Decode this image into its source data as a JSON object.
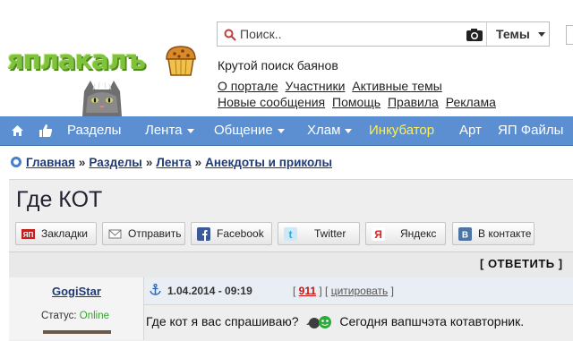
{
  "logo": {
    "text": "яплакалъ"
  },
  "search": {
    "placeholder": "Поиск..",
    "scope": "Темы"
  },
  "tagline": "Крутой поиск баянов",
  "toplinks": {
    "row1": [
      "О портале",
      "Участники",
      "Активные темы"
    ],
    "row2": [
      "Новые сообщения",
      "Помощь",
      "Правила",
      "Реклама"
    ]
  },
  "nav": {
    "items": [
      {
        "label": "Разделы",
        "dropdown": false
      },
      {
        "label": "Лента",
        "dropdown": true
      },
      {
        "label": "Общение",
        "dropdown": true
      },
      {
        "label": "Хлам",
        "dropdown": true
      },
      {
        "label": "Инкубатор",
        "dropdown": false,
        "highlight": true
      },
      {
        "label": "Арт",
        "dropdown": false
      },
      {
        "label": "ЯП Файлы",
        "dropdown": false
      }
    ]
  },
  "breadcrumb": {
    "items": [
      "Главная",
      "Разделы",
      "Лента",
      "Анекдоты и приколы"
    ],
    "separator": "»"
  },
  "topic": {
    "title": "Где КОТ"
  },
  "share": {
    "buttons": [
      {
        "label": "Закладки",
        "icon": "yap-bookmark-icon"
      },
      {
        "label": "Отправить",
        "icon": "envelope-icon"
      },
      {
        "label": "Facebook",
        "icon": "facebook-icon"
      },
      {
        "label": "Twitter",
        "icon": "twitter-icon"
      },
      {
        "label": "Яндекс",
        "icon": "yandex-icon"
      },
      {
        "label": "В контакте",
        "icon": "vkontakte-icon"
      }
    ]
  },
  "reply": {
    "label": "[ ОТВЕТИТЬ ]"
  },
  "post": {
    "author": "GogiStar",
    "status_label": "Статус:",
    "status_value": "Online",
    "date": "1.04.2014 - 09:19",
    "number": "911",
    "quote_label": "цитировать",
    "text_before": "Где кот я вас спрашиваю?",
    "text_after": "Сегодня вапшчэта котавторник."
  },
  "colors": {
    "nav_bg": "#5b8fd1",
    "logo_green": "#7ec33a",
    "incubator": "#ffee55",
    "online": "#3aa02e",
    "link": "#1f3a78"
  }
}
